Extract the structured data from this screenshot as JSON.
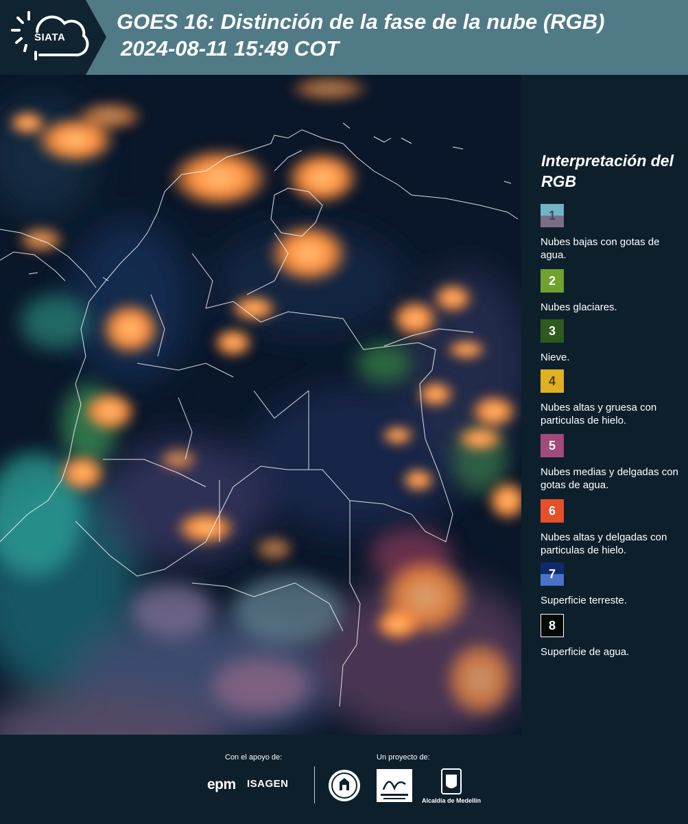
{
  "header": {
    "logo_text": "SIATA",
    "title_line1": "GOES 16: Distinción de la fase de la nube (RGB)",
    "title_line2": "2024-08-11 15:49 COT"
  },
  "image": {
    "description_icon": "satellite-rgb-image"
  },
  "legend": {
    "title": "Interpretación del RGB",
    "items": [
      {
        "number": "1",
        "label": "Nubes bajas con gotas de agua.",
        "color_top": "#6fb5c4",
        "color_bottom": "#7a6e86",
        "number_color": "#4a4458"
      },
      {
        "number": "2",
        "label": "Nubes glaciares.",
        "color_top": "#6fa22f",
        "color_bottom": "#6fa22f",
        "number_color": "#ffffff"
      },
      {
        "number": "3",
        "label": "Nieve.",
        "color_top": "#2e5a1e",
        "color_bottom": "#2e5a1e",
        "number_color": "#ffffff"
      },
      {
        "number": "4",
        "label": "Nubes altas y gruesa con particulas de hielo.",
        "color_top": "#e0b021",
        "color_bottom": "#e0b021",
        "number_color": "#4a4020"
      },
      {
        "number": "5",
        "label": "Nubes medias y delgadas con gotas de agua.",
        "color_top": "#a24a7a",
        "color_bottom": "#a24a7a",
        "number_color": "#ffffff"
      },
      {
        "number": "6",
        "label": "Nubes altas y delgadas con particulas de hielo.",
        "color_top": "#e54f2a",
        "color_bottom": "#e54f2a",
        "number_color": "#ffffff"
      },
      {
        "number": "7",
        "label": "Superficie terreste.",
        "color_top": "#0f2a6a",
        "color_bottom": "#4a73c8",
        "number_color": "#ffffff"
      },
      {
        "number": "8",
        "label": "Superficie de agua.",
        "color_top": "#030a05",
        "color_bottom": "#030a05",
        "number_color": "#ffffff"
      }
    ]
  },
  "footer": {
    "support_label": "Con el apoyo de:",
    "project_label": "Un proyecto de:",
    "epm": "epm",
    "isagen": "ISAGEN",
    "alcaldia": "Alcaldía de Medellín"
  }
}
